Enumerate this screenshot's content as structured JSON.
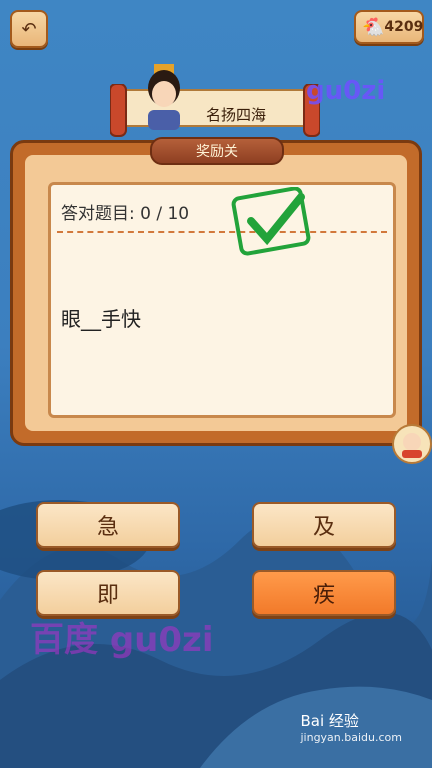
{
  "header": {
    "coins": "4209",
    "level_name": "名扬四海",
    "section_label": "奖励关"
  },
  "watermark_top": "gu0zi",
  "watermark_bottom": "百度 gu0zi",
  "question": {
    "progress": "答对题目: 0 / 10",
    "idiom": "眼__手快"
  },
  "answers": [
    {
      "label": "急"
    },
    {
      "label": "及"
    },
    {
      "label": "即"
    },
    {
      "label": "疾"
    }
  ],
  "footer": {
    "brand": "Bai 经验",
    "url": "jingyan.baidu.com"
  },
  "colors": {
    "board": "#c26b2a",
    "answer_selected": "#f27a2a",
    "check": "#22a33a"
  }
}
